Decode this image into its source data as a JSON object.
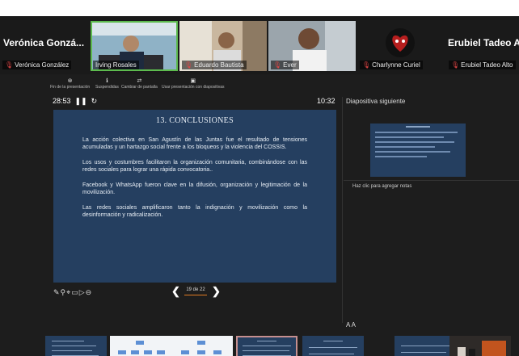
{
  "participants": [
    {
      "name": "Verónica González",
      "big_label": "Verónica Gonzá..."
    },
    {
      "name": "Irving Rosales"
    },
    {
      "name": "Eduardo Bautista"
    },
    {
      "name": "Ever"
    },
    {
      "name": "Charlynne Curiel"
    },
    {
      "name": "Erubiel Tadeo Alto",
      "big_label": "Erubiel Tadeo A"
    }
  ],
  "toolbar": {
    "end": "Fin de la presentación",
    "pause": "Suspendidas",
    "switch": "Cambiar de pantalla",
    "usenodisplay": "Usar presentación con diapositivas"
  },
  "presenter": {
    "timer": "28:53",
    "clock": "10:32",
    "next_label": "Diapositiva siguiente",
    "notes_placeholder": "Haz clic para agregar notas",
    "slide_counter": "19 de 22",
    "font_controls": "A A"
  },
  "slide": {
    "title": "13. CONCLUSIONES",
    "paragraphs": [
      "La acción colectiva en San Agustín de las Juntas fue el resultado de tensiones acumuladas y un hartazgo social frente a los bloqueos y la violencia del COSSIS.",
      "Los usos y costumbres facilitaron la organización comunitaria, combinándose con las redes sociales para lograr una rápida convocatoria..",
      "Facebook y WhatsApp fueron clave en la difusión, organización y legitimación de la movilización.",
      "Las redes sociales amplificaron tanto la indignación y movilización como la desinformación y radicalización."
    ]
  },
  "colors": {
    "slide_bg": "#253f60",
    "active_speaker": "#5dbb4e",
    "progress": "#e07b24",
    "muted_mic": "#e04646"
  }
}
